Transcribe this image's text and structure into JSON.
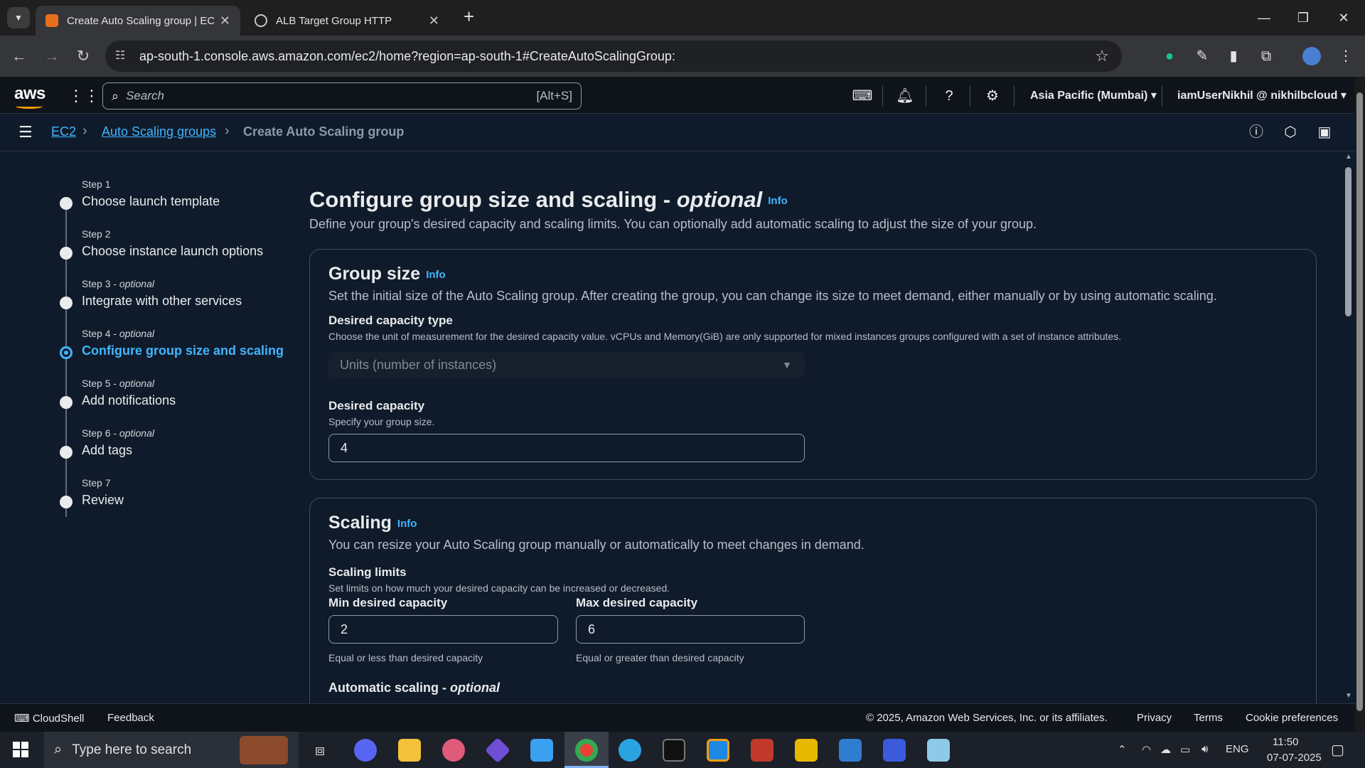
{
  "browser": {
    "tabs": [
      {
        "title": "Create Auto Scaling group | EC2",
        "active": true
      },
      {
        "title": "ALB Target Group HTTP",
        "active": false
      }
    ],
    "new_tab": "+",
    "url": "ap-south-1.console.aws.amazon.com/ec2/home?region=ap-south-1#CreateAutoScalingGroup:"
  },
  "aws_header": {
    "logo": "aws",
    "search_placeholder": "Search",
    "search_shortcut": "[Alt+S]",
    "region": "Asia Pacific (Mumbai)",
    "account": "iamUserNikhil @ nikhilbcloud"
  },
  "breadcrumb": [
    {
      "label": "EC2",
      "link": true
    },
    {
      "label": "Auto Scaling groups",
      "link": true
    },
    {
      "label": "Create Auto Scaling group",
      "link": false
    }
  ],
  "steps": [
    {
      "num": "Step 1",
      "optional": "",
      "label": "Choose launch template",
      "active": false
    },
    {
      "num": "Step 2",
      "optional": "",
      "label": "Choose instance launch options",
      "active": false
    },
    {
      "num": "Step 3 - ",
      "optional": "optional",
      "label": "Integrate with other services",
      "active": false
    },
    {
      "num": "Step 4 - ",
      "optional": "optional",
      "label": "Configure group size and scaling",
      "active": true
    },
    {
      "num": "Step 5 - ",
      "optional": "optional",
      "label": "Add notifications",
      "active": false
    },
    {
      "num": "Step 6 - ",
      "optional": "optional",
      "label": "Add tags",
      "active": false
    },
    {
      "num": "Step 7",
      "optional": "",
      "label": "Review",
      "active": false
    }
  ],
  "page": {
    "title": "Configure group size and scaling - ",
    "title_optional": "optional",
    "info": "Info",
    "description": "Define your group's desired capacity and scaling limits. You can optionally add automatic scaling to adjust the size of your group."
  },
  "group_size": {
    "heading": "Group size",
    "info": "Info",
    "description": "Set the initial size of the Auto Scaling group. After creating the group, you can change its size to meet demand, either manually or by using automatic scaling.",
    "capacity_type_label": "Desired capacity type",
    "capacity_type_desc": "Choose the unit of measurement for the desired capacity value. vCPUs and Memory(GiB) are only supported for mixed instances groups configured with a set of instance attributes.",
    "capacity_type_value": "Units (number of instances)",
    "desired_label": "Desired capacity",
    "desired_desc": "Specify your group size.",
    "desired_value": "4"
  },
  "scaling": {
    "heading": "Scaling",
    "info": "Info",
    "description": "You can resize your Auto Scaling group manually or automatically to meet changes in demand.",
    "limits_label": "Scaling limits",
    "limits_desc": "Set limits on how much your desired capacity can be increased or decreased.",
    "min_label": "Min desired capacity",
    "min_value": "2",
    "min_hint": "Equal or less than desired capacity",
    "max_label": "Max desired capacity",
    "max_value": "6",
    "max_hint": "Equal or greater than desired capacity",
    "auto_label": "Automatic scaling - ",
    "auto_optional": "optional"
  },
  "footer": {
    "cloudshell": "CloudShell",
    "feedback": "Feedback",
    "copyright": "© 2025, Amazon Web Services, Inc. or its affiliates.",
    "privacy": "Privacy",
    "terms": "Terms",
    "cookies": "Cookie preferences"
  },
  "taskbar": {
    "search_placeholder": "Type here to search",
    "language": "ENG",
    "time": "11:50",
    "date": "07-07-2025"
  },
  "colors": {
    "accent": "#42b4ff",
    "aws_orange": "#ff9900",
    "background": "#0f1b2a"
  }
}
